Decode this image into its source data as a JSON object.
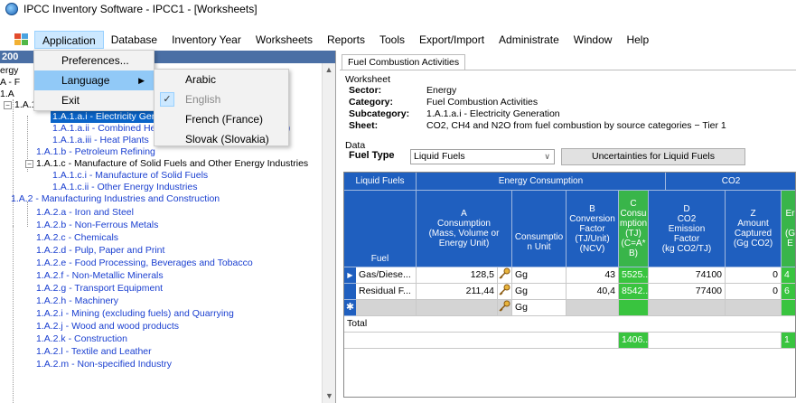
{
  "window": {
    "title": "IPCC Inventory Software - IPCC1 - [Worksheets]"
  },
  "menubar": {
    "items": [
      "Application",
      "Database",
      "Inventory Year",
      "Worksheets",
      "Reports",
      "Tools",
      "Export/Import",
      "Administrate",
      "Window",
      "Help"
    ]
  },
  "app_menu": {
    "items": [
      "Preferences...",
      "Language",
      "Exit"
    ]
  },
  "language_menu": {
    "items": [
      "Arabic",
      "English",
      "French (France)",
      "Slovak (Slovakia)"
    ],
    "checked": "English"
  },
  "leftpane": {
    "header": "200",
    "tree_partial": [
      "ergy",
      "A - F",
      "1.A"
    ],
    "nodes": [
      {
        "label": "1.A.1.a - Main Activity Electr",
        "exp": "−"
      },
      {
        "label": "1.A.1.a.i - Electricity Gen",
        "selected": true
      },
      {
        "label": "1.A.1.a.ii - Combined Heat and Power Generation (CHP)"
      },
      {
        "label": "1.A.1.a.iii - Heat Plants"
      },
      {
        "label": "1.A.1.b - Petroleum Refining"
      },
      {
        "label": "1.A.1.c - Manufacture of Solid Fuels and Other Energy Industries",
        "exp": "−"
      },
      {
        "label": "1.A.1.c.i - Manufacture of Solid Fuels"
      },
      {
        "label": "1.A.1.c.ii - Other Energy Industries"
      },
      {
        "label": "1.A.2 - Manufacturing Industries and Construction"
      },
      {
        "label": "1.A.2.a - Iron and Steel"
      },
      {
        "label": "1.A.2.b - Non-Ferrous Metals"
      },
      {
        "label": "1.A.2.c - Chemicals"
      },
      {
        "label": "1.A.2.d - Pulp, Paper and Print"
      },
      {
        "label": "1.A.2.e - Food Processing, Beverages and Tobacco"
      },
      {
        "label": "1.A.2.f - Non-Metallic Minerals"
      },
      {
        "label": "1.A.2.g - Transport Equipment"
      },
      {
        "label": "1.A.2.h - Machinery"
      },
      {
        "label": "1.A.2.i - Mining (excluding fuels) and Quarrying"
      },
      {
        "label": "1.A.2.j - Wood and wood products"
      },
      {
        "label": "1.A.2.k - Construction"
      },
      {
        "label": "1.A.2.l - Textile and Leather"
      },
      {
        "label": "1.A.2.m - Non-specified Industry"
      }
    ]
  },
  "worksheet": {
    "tab": "Fuel Combustion Activities",
    "section": "Worksheet",
    "sector_label": "Sector:",
    "sector": "Energy",
    "category_label": "Category:",
    "category": "Fuel Combustion Activities",
    "subcategory_label": "Subcategory:",
    "subcategory": "1.A.1.a.i - Electricity Generation",
    "sheet_label": "Sheet:",
    "sheet": "CO2, CH4 and N2O from fuel combustion by source categories − Tier 1",
    "data_label": "Data",
    "fuel_type_label": "Fuel Type",
    "fuel_type_value": "Liquid Fuels",
    "uncertainties_button": "Uncertainties for Liquid Fuels"
  },
  "grid": {
    "group_headers": [
      "Liquid Fuels",
      "Energy Consumption",
      "CO2"
    ],
    "col_headers": {
      "fuel": "Fuel",
      "a": "A\nConsumption\n(Mass, Volume or\nEnergy Unit)",
      "unit": "Consumptio\nn Unit",
      "b": "B\nConversion\nFactor\n(TJ/Unit)\n(NCV)",
      "c": "C\nConsu\nmption\n(TJ)\n(C=A*\nB)",
      "d": "D\nCO2\nEmission\nFactor\n(kg CO2/TJ)",
      "z": "Z\nAmount\nCaptured\n(Gg CO2)",
      "e": "Er\n\n(G\nE"
    },
    "rows": [
      {
        "fuel": "Gas/Diese...",
        "a": "128,5",
        "unit": "Gg",
        "b": "43",
        "c": "5525...",
        "d": "74100",
        "z": "0",
        "e": "4"
      },
      {
        "fuel": "Residual F...",
        "a": "211,44",
        "unit": "Gg",
        "b": "40,4",
        "c": "8542...",
        "d": "77400",
        "z": "0",
        "e": "6"
      },
      {
        "fuel": "",
        "a": "",
        "unit": "Gg",
        "b": "",
        "c": "",
        "d": "",
        "z": "",
        "e": ""
      }
    ],
    "total_label": "Total",
    "total_c": "1406...",
    "total_e": "1"
  }
}
